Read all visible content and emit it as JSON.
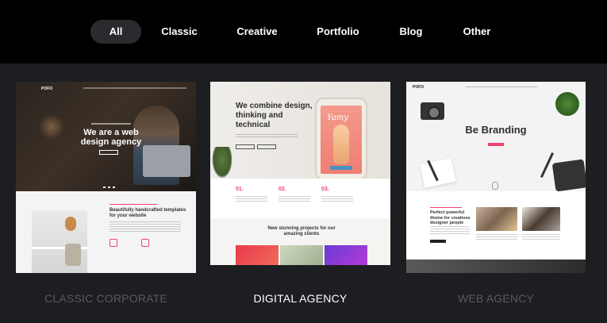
{
  "filters": [
    {
      "label": "All",
      "active": true
    },
    {
      "label": "Classic",
      "active": false
    },
    {
      "label": "Creative",
      "active": false
    },
    {
      "label": "Portfolio",
      "active": false
    },
    {
      "label": "Blog",
      "active": false
    },
    {
      "label": "Other",
      "active": false
    }
  ],
  "colors": {
    "topbar": "#000000",
    "page_bg": "#1d1e21",
    "accent_pink": "#f0426b",
    "label_muted": "#5a5a5a",
    "label_active": "#ffffff"
  },
  "cards": [
    {
      "label": "CLASSIC CORPORATE",
      "state": "muted",
      "preview": {
        "logo": "POFO",
        "headline": "We are a web design agency",
        "subheadline": "Beautifully handcrafted templates for your website"
      }
    },
    {
      "label": "DIGITAL AGENCY",
      "state": "active",
      "preview": {
        "headline": "We combine design, thinking and technical",
        "phone_text": "Yamy",
        "features": [
          "01.",
          "02.",
          "03."
        ],
        "clients_heading": "New stunning projects for our amazing clients"
      }
    },
    {
      "label": "WEB AGENCY",
      "state": "muted",
      "preview": {
        "logo": "POFO",
        "headline": "Be Branding",
        "subheadline": "Perfect powerful theme for creatives designer people"
      }
    }
  ]
}
